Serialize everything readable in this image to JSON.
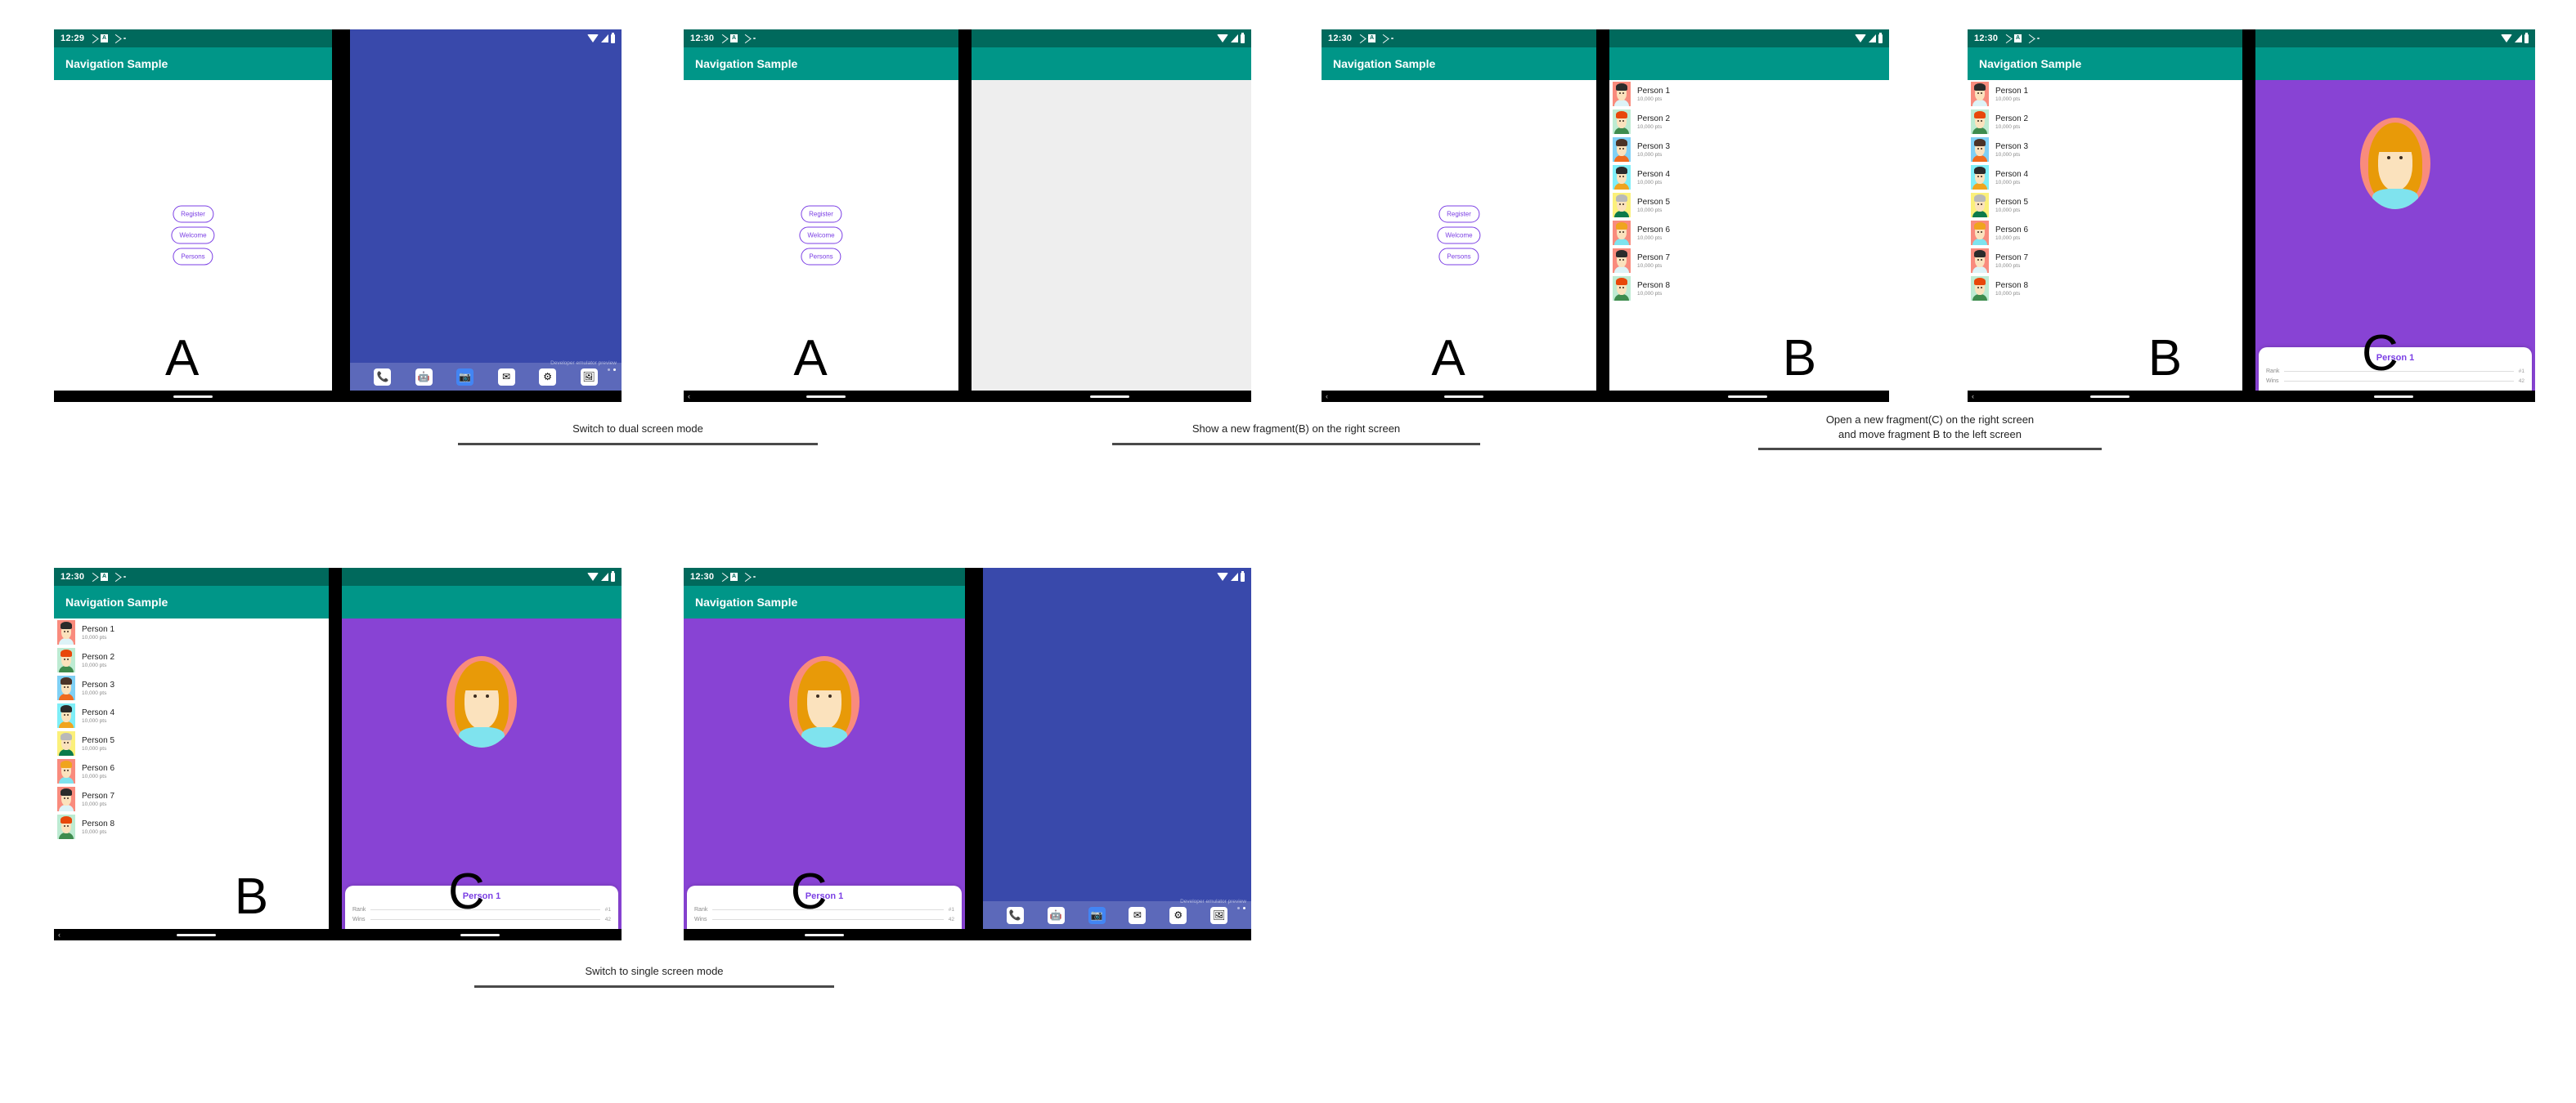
{
  "app": {
    "title": "Navigation Sample",
    "accent_teal": "#009688",
    "accent_teal_dark": "#00695c",
    "accent_purple": "#7b3fe4",
    "detail_bg": "#8843d4",
    "wallpaper": "#3949ab"
  },
  "status": {
    "time_1229": "12:29",
    "time_1230": "12:30",
    "box_glyph": "A",
    "icons": [
      "share-icon",
      "app-badge-icon",
      "share-icon",
      "dot-icon"
    ],
    "right_icons": [
      "wifi-icon",
      "signal-icon",
      "battery-icon"
    ]
  },
  "fragment_a": {
    "buttons": [
      "Register",
      "Welcome",
      "Persons"
    ],
    "letter": "A"
  },
  "fragment_b": {
    "letter": "B",
    "persons": [
      {
        "name": "Person 1",
        "points": "10,000 pts",
        "bg": "#f98b7d",
        "hair": "#2b2b2b",
        "shirt": "#ddf3f7"
      },
      {
        "name": "Person 2",
        "points": "10,000 pts",
        "bg": "#bdebd2",
        "hair": "#e8470a",
        "shirt": "#3e8c4e"
      },
      {
        "name": "Person 3",
        "points": "10,000 pts",
        "bg": "#7fd0f5",
        "hair": "#4b3327",
        "shirt": "#f06a1e"
      },
      {
        "name": "Person 4",
        "points": "10,000 pts",
        "bg": "#7eeef7",
        "hair": "#2b2b2b",
        "shirt": "#f0a41e"
      },
      {
        "name": "Person 5",
        "points": "10,000 pts",
        "bg": "#fbf07a",
        "hair": "#b9b9b9",
        "shirt": "#0c7a4a"
      },
      {
        "name": "Person 6",
        "points": "10,000 pts",
        "bg": "#f98b7d",
        "hair": "#f0a41e",
        "shirt": "#7fe3ee"
      },
      {
        "name": "Person 7",
        "points": "10,000 pts",
        "bg": "#f98b7d",
        "hair": "#2b2b2b",
        "shirt": "#ddf3f7"
      },
      {
        "name": "Person 8",
        "points": "10,000 pts",
        "bg": "#bdebd2",
        "hair": "#e8470a",
        "shirt": "#3e8c4e"
      }
    ]
  },
  "fragment_c": {
    "letter": "C",
    "title": "Person 1",
    "stats": [
      {
        "label": "Rank",
        "value": "#1"
      },
      {
        "label": "Wins",
        "value": "42"
      }
    ]
  },
  "launcher": {
    "watermark": "Developer emulator preview",
    "dock": [
      {
        "name": "phone-icon",
        "glyph": "📞",
        "blue": false
      },
      {
        "name": "messages-icon",
        "glyph": "🤖",
        "blue": false
      },
      {
        "name": "camera-icon",
        "glyph": "📷",
        "blue": true
      },
      {
        "name": "email-icon",
        "glyph": "✉",
        "blue": false
      },
      {
        "name": "settings-icon",
        "glyph": "⚙",
        "blue": false
      },
      {
        "name": "browser-icon",
        "glyph": "🖼",
        "blue": false
      }
    ]
  },
  "captions": {
    "c1": "Switch to dual screen mode",
    "c2": "Show  a new fragment(B) on the right screen",
    "c3": "Open a new fragment(C) on the right screen\nand move fragment B to the left screen",
    "c4": "Switch to single screen mode"
  }
}
